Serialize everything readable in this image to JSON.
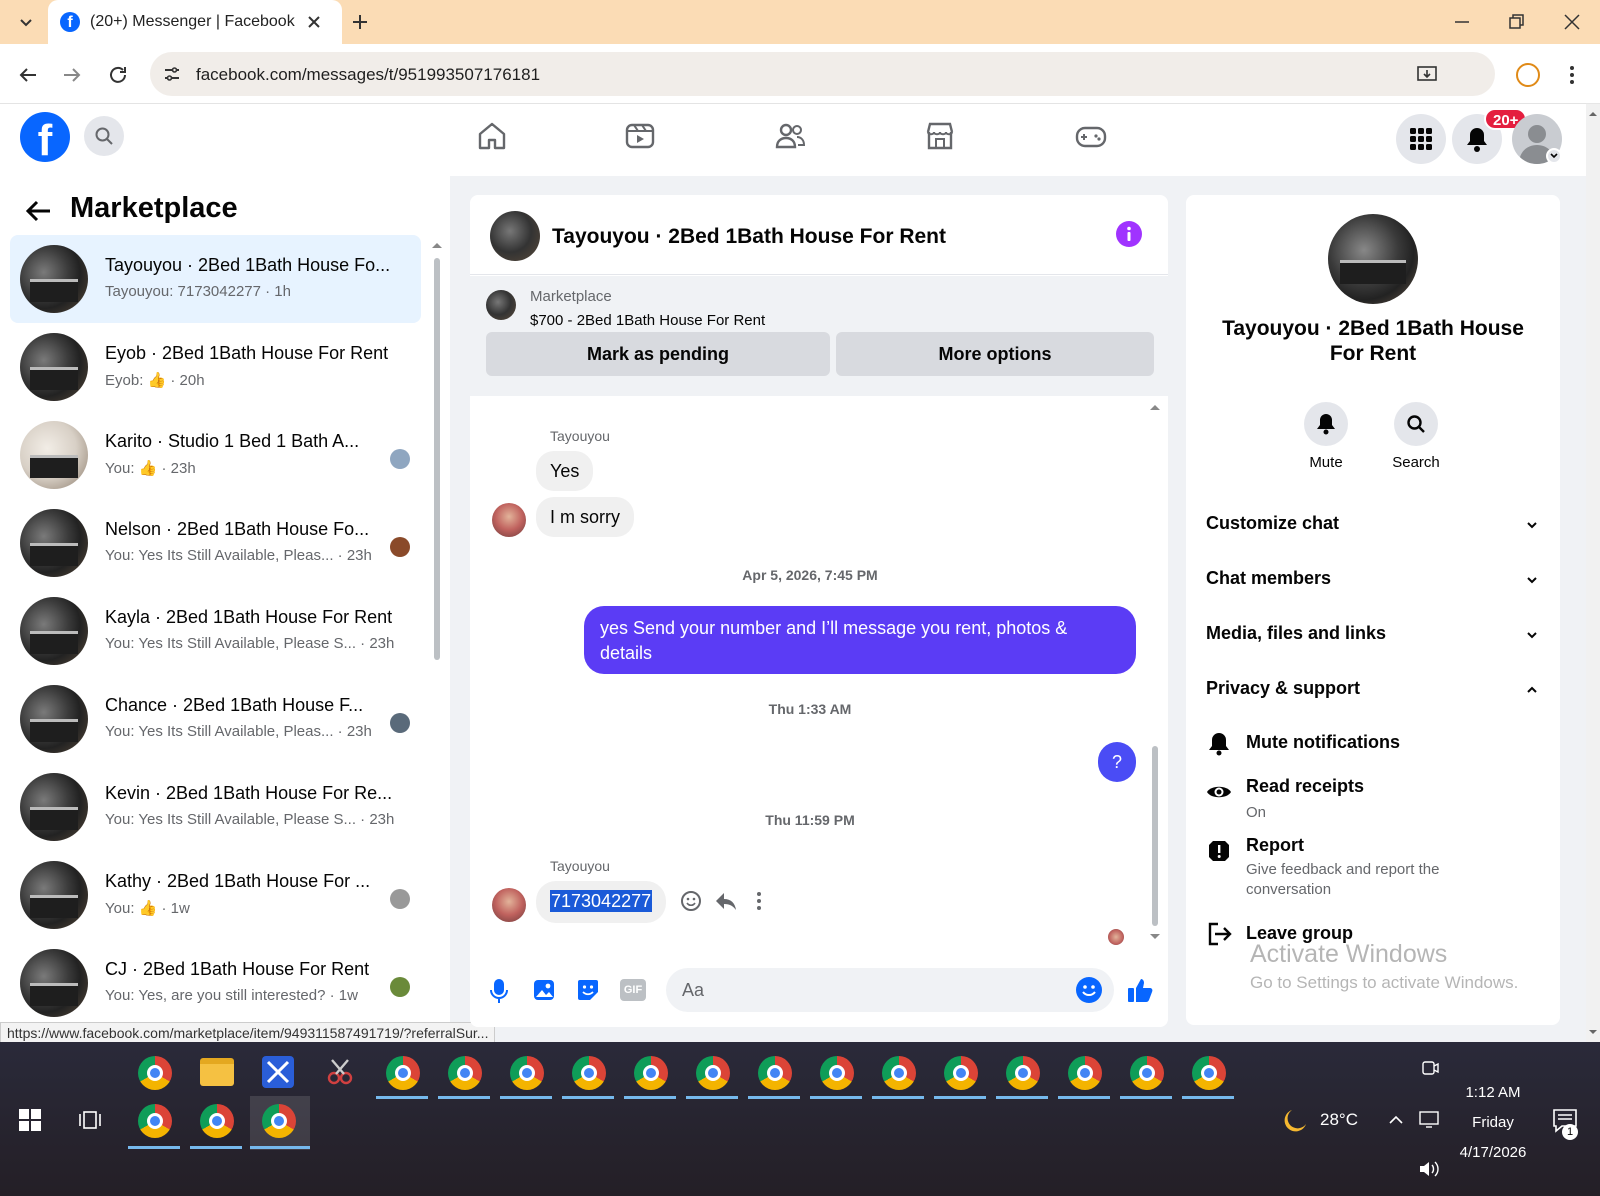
{
  "browser": {
    "tab_title": "(20+) Messenger | Facebook",
    "url": "facebook.com/messages/t/951993507176181",
    "status_url": "https://www.facebook.com/marketplace/item/949311587491719/?referralSur..."
  },
  "topbar": {
    "notification_badge": "20+"
  },
  "left": {
    "title": "Marketplace",
    "conversations": [
      {
        "name": "Tayouyou · 2Bed 1Bath House Fo...",
        "sub": "Tayouyou: 7173042277 · 1h"
      },
      {
        "name": "Eyob · 2Bed 1Bath House For Rent",
        "sub": "Eyob: 👍 · 20h"
      },
      {
        "name": "Karito · Studio 1 Bed 1 Bath A...",
        "sub": "You: 👍 · 23h"
      },
      {
        "name": "Nelson · 2Bed 1Bath House Fo...",
        "sub": "You: Yes Its Still Available, Pleas... · 23h"
      },
      {
        "name": "Kayla · 2Bed 1Bath House For Rent",
        "sub": "You: Yes Its Still Available, Please S... · 23h"
      },
      {
        "name": "Chance · 2Bed 1Bath House F...",
        "sub": "You: Yes Its Still Available, Pleas... · 23h"
      },
      {
        "name": "Kevin · 2Bed 1Bath House For Re...",
        "sub": "You: Yes Its Still Available, Please S... · 23h"
      },
      {
        "name": "Kathy · 2Bed 1Bath House For ...",
        "sub": "You: 👍 · 1w"
      },
      {
        "name": "CJ · 2Bed 1Bath House For Rent",
        "sub": "You: Yes, are you still interested? · 1w"
      }
    ]
  },
  "chat": {
    "title": "Tayouyou · 2Bed 1Bath House For Rent",
    "listing_label": "Marketplace",
    "listing_detail": "$700 - 2Bed 1Bath House For Rent",
    "mark_pending": "Mark as pending",
    "more_options": "More options",
    "sender1": "Tayouyou",
    "msg_yes": "Yes",
    "msg_sorry": "I m sorry",
    "ts1": "Apr 5, 2026, 7:45 PM",
    "msg_out_line1": "yes  Send your number and I’ll message you rent, photos &",
    "msg_out_line2": "details",
    "ts2": "Thu 1:33 AM",
    "msg_q": "?",
    "ts3": "Thu 11:59 PM",
    "sender2": "Tayouyou",
    "msg_number": "7173042277",
    "composer_placeholder": "Aa"
  },
  "info": {
    "name_line1": "Tayouyou · 2Bed 1Bath House",
    "name_line2": "For Rent",
    "mute": "Mute",
    "search": "Search",
    "customize": "Customize chat",
    "members": "Chat members",
    "media": "Media, files and links",
    "privacy": "Privacy & support",
    "mute_notif": "Mute notifications",
    "read_receipts": "Read receipts",
    "read_receipts_val": "On",
    "report": "Report",
    "report_sub1": "Give feedback and report the",
    "report_sub2": "conversation",
    "leave": "Leave group",
    "watermark1": "Activate Windows",
    "watermark2": "Go to Settings to activate Windows."
  },
  "taskbar": {
    "temp": "28°C",
    "time": "1:12 AM",
    "day": "Friday",
    "date": "4/17/2026",
    "notif_count": "1"
  },
  "colors": {
    "fb_blue": "#0866ff",
    "outgoing_bubble": "#5b3cf5",
    "badge_red": "#e41e3f",
    "info_purple": "#a033ff"
  }
}
